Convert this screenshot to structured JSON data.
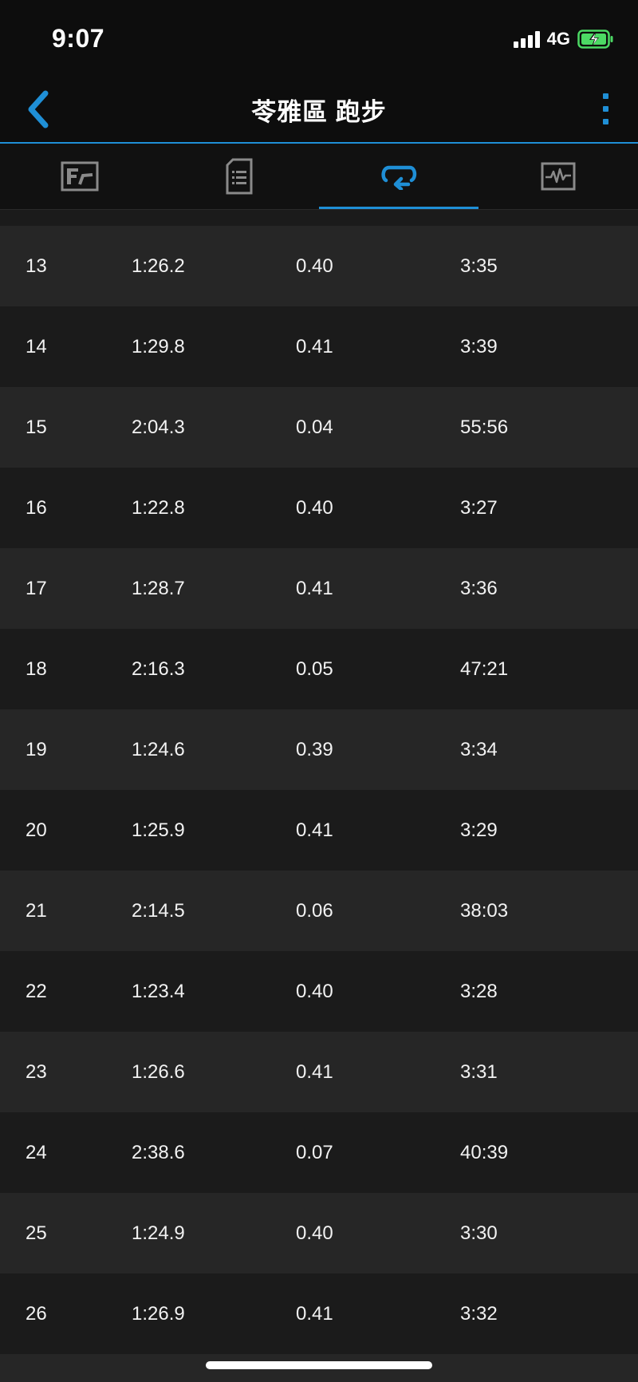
{
  "status_bar": {
    "time": "9:07",
    "network": "4G",
    "battery_state": "charging"
  },
  "nav": {
    "title": "苓雅區 跑步",
    "accent_color": "#1f8fd6"
  },
  "tabs": [
    {
      "icon": "summary-chart-icon",
      "active": false
    },
    {
      "icon": "details-list-icon",
      "active": false
    },
    {
      "icon": "laps-loop-icon",
      "active": true
    },
    {
      "icon": "graphs-pulse-icon",
      "active": false
    }
  ],
  "laps": [
    {
      "lap": "13",
      "time": "1:26.2",
      "distance": "0.40",
      "pace": "3:35"
    },
    {
      "lap": "14",
      "time": "1:29.8",
      "distance": "0.41",
      "pace": "3:39"
    },
    {
      "lap": "15",
      "time": "2:04.3",
      "distance": "0.04",
      "pace": "55:56"
    },
    {
      "lap": "16",
      "time": "1:22.8",
      "distance": "0.40",
      "pace": "3:27"
    },
    {
      "lap": "17",
      "time": "1:28.7",
      "distance": "0.41",
      "pace": "3:36"
    },
    {
      "lap": "18",
      "time": "2:16.3",
      "distance": "0.05",
      "pace": "47:21"
    },
    {
      "lap": "19",
      "time": "1:24.6",
      "distance": "0.39",
      "pace": "3:34"
    },
    {
      "lap": "20",
      "time": "1:25.9",
      "distance": "0.41",
      "pace": "3:29"
    },
    {
      "lap": "21",
      "time": "2:14.5",
      "distance": "0.06",
      "pace": "38:03"
    },
    {
      "lap": "22",
      "time": "1:23.4",
      "distance": "0.40",
      "pace": "3:28"
    },
    {
      "lap": "23",
      "time": "1:26.6",
      "distance": "0.41",
      "pace": "3:31"
    },
    {
      "lap": "24",
      "time": "2:38.6",
      "distance": "0.07",
      "pace": "40:39"
    },
    {
      "lap": "25",
      "time": "1:24.9",
      "distance": "0.40",
      "pace": "3:30"
    },
    {
      "lap": "26",
      "time": "1:26.9",
      "distance": "0.41",
      "pace": "3:32"
    }
  ]
}
